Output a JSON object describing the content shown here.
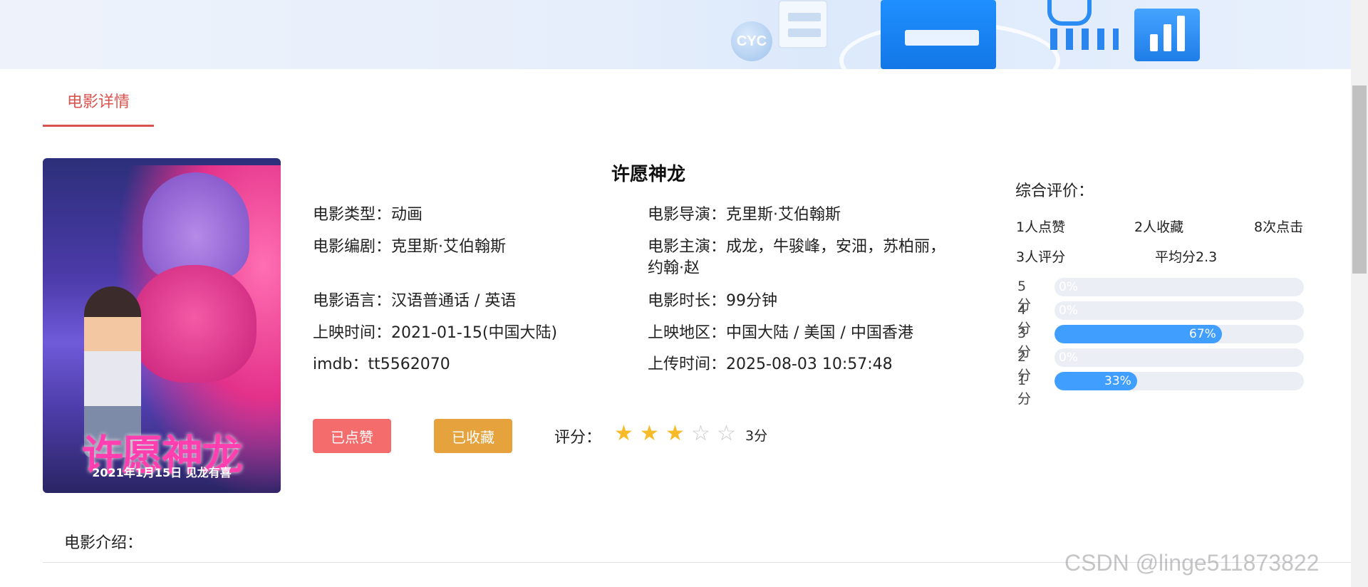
{
  "banner": {
    "badge_text": "CYC"
  },
  "tab": {
    "label": "电影详情"
  },
  "poster": {
    "title_text": "许愿神龙",
    "subtitle_text": "2021年1月15日  见龙有喜",
    "colors": {
      "primary": "#e3318a",
      "background": "#4b3aa8"
    }
  },
  "movie": {
    "title": "许愿神龙",
    "type_label": "电影类型：",
    "type_value": "动画",
    "director_label": "电影导演：",
    "director_value": "克里斯·艾伯翰斯",
    "writer_label": "电影编剧：",
    "writer_value": "克里斯·艾伯翰斯",
    "cast_label": "电影主演：",
    "cast_value": "成龙，牛骏峰，安沺，苏柏丽，约翰·赵",
    "language_label": "电影语言：",
    "language_value": "汉语普通话 / 英语",
    "duration_label": "电影时长：",
    "duration_value": "99分钟",
    "release_label": "上映时间：",
    "release_value": "2021-01-15(中国大陆)",
    "region_label": "上映地区：",
    "region_value": "中国大陆 / 美国 / 中国香港",
    "imdb_label": "imdb：",
    "imdb_value": "tt5562070",
    "upload_label": "上传时间：",
    "upload_value": "2025-08-03 10:57:48"
  },
  "actions": {
    "like_label": "已点赞",
    "favorite_label": "已收藏",
    "rating_label": "评分：",
    "rating_stars": 3,
    "rating_max": 5,
    "rating_text": "3分"
  },
  "summary": {
    "title": "综合评价：",
    "likes": "1人点赞",
    "favorites": "2人收藏",
    "clicks": "8次点击",
    "raters": "3人评分",
    "average": "平均分2.3",
    "distribution": [
      {
        "label": "5分",
        "percent": 0,
        "text": "0%"
      },
      {
        "label": "4分",
        "percent": 0,
        "text": "0%"
      },
      {
        "label": "3分",
        "percent": 67,
        "text": "67%"
      },
      {
        "label": "2分",
        "percent": 0,
        "text": "0%"
      },
      {
        "label": "1分",
        "percent": 33,
        "text": "33%"
      }
    ],
    "colors": {
      "bar": "#409eff",
      "track": "#ebeef5"
    }
  },
  "intro": {
    "label": "电影介绍："
  },
  "watermark": {
    "text": "CSDN @linge511873822"
  },
  "colors": {
    "accent": "#d9534f",
    "like_button": "#f56c6c",
    "favorite_button": "#e6a23c",
    "star_on": "#f7ba2a",
    "star_off": "#c8c8c8"
  }
}
